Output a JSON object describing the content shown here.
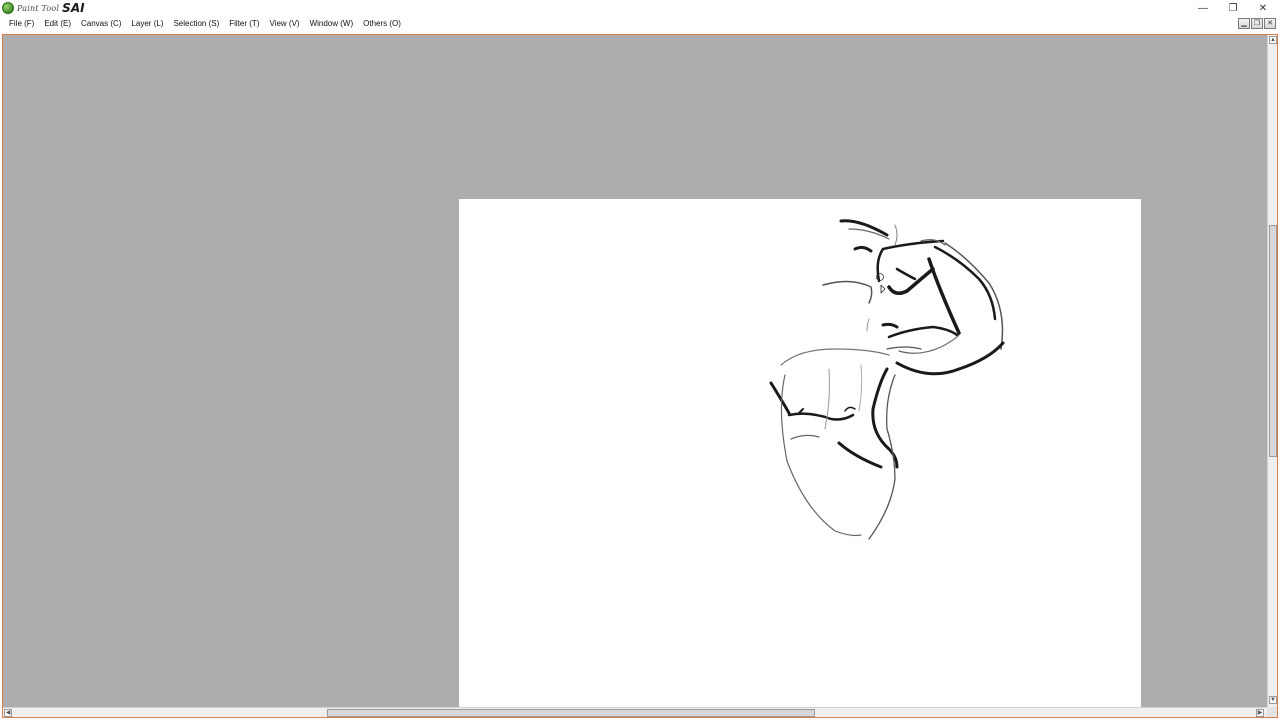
{
  "app": {
    "logo_small": "Paint Tool",
    "logo_big": "SAI"
  },
  "window_controls": {
    "minimize": "—",
    "restore": "❐",
    "close": "✕"
  },
  "menu": {
    "items": [
      {
        "label": "File (F)"
      },
      {
        "label": "Edit (E)"
      },
      {
        "label": "Canvas (C)"
      },
      {
        "label": "Layer (L)"
      },
      {
        "label": "Selection (S)"
      },
      {
        "label": "Filter (T)"
      },
      {
        "label": "View (V)"
      },
      {
        "label": "Window (W)"
      },
      {
        "label": "Others (O)"
      }
    ]
  },
  "mdi_controls": {
    "minimize": "▁",
    "restore": "❐",
    "close": "✕"
  },
  "canvas": {
    "background_color": "#adadad",
    "paper_color": "#ffffff",
    "frame_accent": "#d97a4b",
    "sketch_stroke": "#1a1a1a"
  },
  "scrollbars": {
    "up_arrow": "▲",
    "down_arrow": "▼",
    "left_arrow": "◀",
    "right_arrow": "▶",
    "vertical_position": 0.38,
    "horizontal_position": 0.42
  }
}
